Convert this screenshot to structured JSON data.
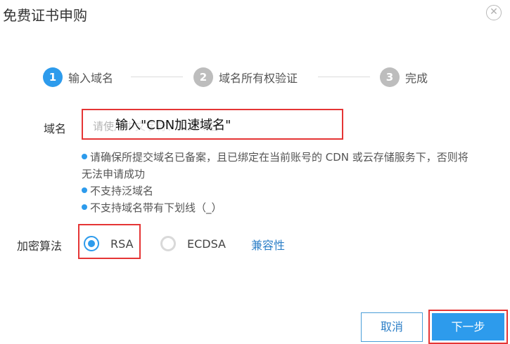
{
  "dialog": {
    "title": "免费证书申购",
    "close_icon": "close-icon"
  },
  "steps": [
    {
      "number": "1",
      "label": "输入域名",
      "state": "active"
    },
    {
      "number": "2",
      "label": "域名所有权验证",
      "state": "inactive"
    },
    {
      "number": "3",
      "label": "完成",
      "state": "inactive"
    }
  ],
  "domain": {
    "label": "域名",
    "placeholder": "请使用中文字符、英文域名",
    "annotation": "输入\"CDN加速域名\""
  },
  "hints": [
    "请确保所提交域名已备案，且已绑定在当前账号的 CDN 或云存储服务下，否则将无法申请成功",
    "不支持泛域名",
    "不支持域名带有下划线（_）"
  ],
  "algorithm": {
    "label": "加密算法",
    "options": [
      {
        "label": "RSA",
        "checked": true
      },
      {
        "label": "ECDSA",
        "checked": false
      }
    ],
    "compat_link": "兼容性"
  },
  "buttons": {
    "cancel": "取消",
    "next": "下一步"
  },
  "colors": {
    "accent": "#2d9bec",
    "highlight_border": "#e53535",
    "inactive_step": "#bdbdbd"
  }
}
